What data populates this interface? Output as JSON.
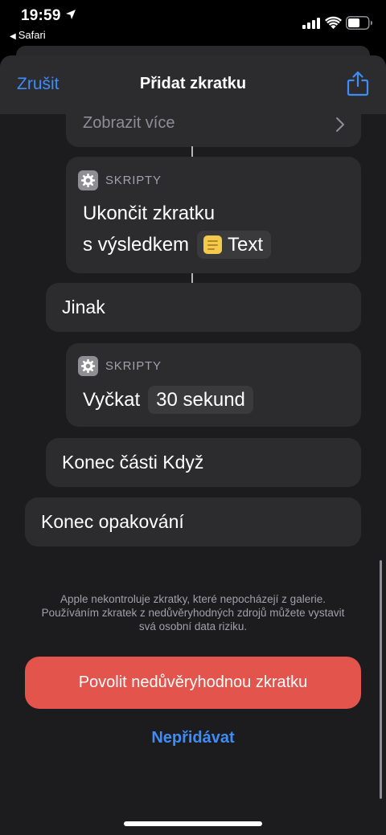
{
  "status_bar": {
    "time": "19:59",
    "back_app": "Safari",
    "icons": [
      "location-arrow-icon",
      "signal-icon",
      "wifi-icon",
      "battery-icon"
    ]
  },
  "nav": {
    "cancel_label": "Zrušit",
    "title": "Přidat zkratku",
    "share_icon": "share-icon"
  },
  "actions": {
    "show_more": "Zobrazit více",
    "stop_card": {
      "category": "SKRIPTY",
      "line1": "Ukončit zkratku",
      "line2_prefix": "s výsledkem",
      "token": "Text"
    },
    "otherwise": "Jinak",
    "wait_card": {
      "category": "SKRIPTY",
      "prefix": "Vyčkat",
      "token": "30 sekund"
    },
    "end_if": "Konec části Když",
    "end_repeat": "Konec opakování"
  },
  "disclaimer": "Apple nekontroluje zkratky, které nepocházejí z galerie. Používáním zkratek z nedůvěryhodných zdrojů můžete vystavit svá osobní data riziku.",
  "buttons": {
    "allow_untrusted": "Povolit nedůvěryhodnou zkratku",
    "dont_add": "Nepřidávat"
  },
  "colors": {
    "accent": "#3f8cf6",
    "danger": "#e3554c",
    "card": "#2c2c2e",
    "background": "#1c1c1e"
  }
}
